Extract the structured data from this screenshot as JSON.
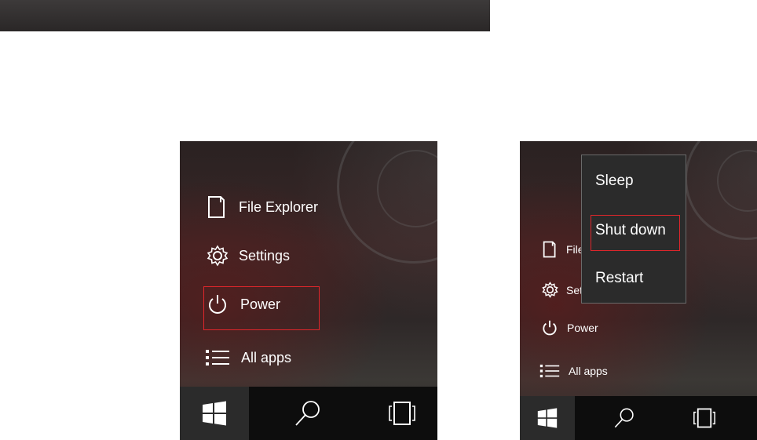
{
  "left_panel": {
    "menu": [
      {
        "label": "File Explorer",
        "icon": "file-explorer-icon"
      },
      {
        "label": "Settings",
        "icon": "gear-icon"
      },
      {
        "label": "Power",
        "icon": "power-icon"
      },
      {
        "label": "All apps",
        "icon": "list-icon"
      }
    ]
  },
  "right_panel": {
    "menu": [
      {
        "label": "File Explorer",
        "icon": "file-explorer-icon"
      },
      {
        "label": "Settings",
        "icon": "gear-icon"
      },
      {
        "label": "Power",
        "icon": "power-icon"
      },
      {
        "label": "All apps",
        "icon": "list-icon"
      }
    ],
    "power_flyout": {
      "items": [
        "Sleep",
        "Shut down",
        "Restart"
      ]
    }
  },
  "taskbar": {
    "icons": [
      "windows-start-icon",
      "search-icon",
      "task-view-icon"
    ]
  },
  "colors": {
    "highlight": "#e0262b",
    "taskbar": "#0d0d0d",
    "flyout_bg": "#2b2b2b"
  }
}
